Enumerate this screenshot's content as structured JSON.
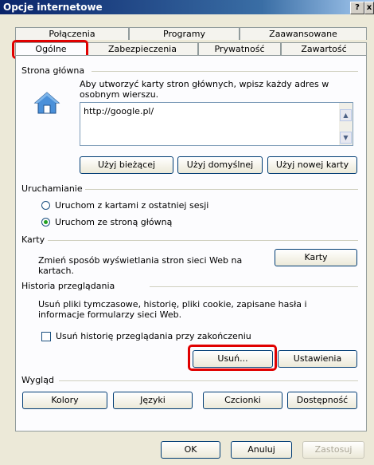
{
  "window": {
    "title": "Opcje internetowe",
    "help_label": "?",
    "close_label": "x"
  },
  "tabs": {
    "back": [
      "Połączenia",
      "Programy",
      "Zaawansowane"
    ],
    "front": [
      "Ogólne",
      "Zabezpieczenia",
      "Prywatność",
      "Zawartość"
    ],
    "active": "Ogólne"
  },
  "home_page": {
    "section_label": "Strona główna",
    "description": "Aby utworzyć karty stron głównych, wpisz każdy adres w osobnym wierszu.",
    "url_value": "http://google.pl/",
    "use_current_label": "Użyj bieżącej",
    "use_default_label": "Użyj domyślnej",
    "use_new_tab_label": "Użyj nowej karty"
  },
  "startup": {
    "section_label": "Uruchamianie",
    "option_last_session": "Uruchom z kartami z ostatniej sesji",
    "option_home_page": "Uruchom ze stroną główną",
    "selected": "option_home_page"
  },
  "tabs_section": {
    "section_label": "Karty",
    "description": "Zmień sposób wyświetlania stron sieci Web na kartach.",
    "tabs_button_label": "Karty"
  },
  "history": {
    "section_label": "Historia przeglądania",
    "description": "Usuń pliki tymczasowe, historię, pliki cookie, zapisane hasła i informacje formularzy sieci Web.",
    "delete_on_exit_label": "Usuń historię przeglądania przy zakończeniu",
    "delete_on_exit_checked": false,
    "delete_button_label": "Usuń...",
    "settings_button_label": "Ustawienia"
  },
  "appearance": {
    "section_label": "Wygląd",
    "colors_label": "Kolory",
    "languages_label": "Języki",
    "fonts_label": "Czcionki",
    "accessibility_label": "Dostępność"
  },
  "footer": {
    "ok_label": "OK",
    "cancel_label": "Anuluj",
    "apply_label": "Zastosuj"
  },
  "colors": {
    "highlight": "#e00000",
    "title_bar": "#0a246a",
    "radio_dot": "#21a121"
  }
}
